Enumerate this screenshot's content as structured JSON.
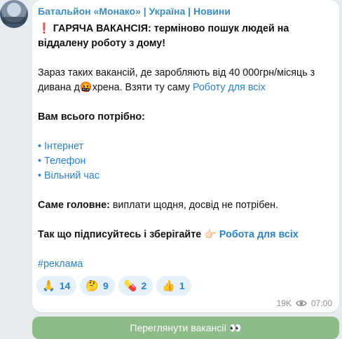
{
  "post": {
    "channel_name": "Батальйон «Монако» | Україна | Новини",
    "headline_icon": "❗",
    "headline": "ГАРЯЧА ВАКАНСІЯ: терміново пошук людей на віддалену роботу з дому!",
    "para1_part1": "Зараз таких вакансій, де заробляють від 40 000грн/місяць з дивана д",
    "para1_emoji": "🤬",
    "para1_part2": "хрена. Взяти ту саму ",
    "para1_link": "Роботу для всіх",
    "needs_title": "Вам всього потрібно:",
    "needs": [
      "• Інтернет",
      "• Телефон",
      "• Вільний час"
    ],
    "main_label": "Саме головне:",
    "main_text": " виплати щодня, досвід не потрібен.",
    "subscribe_text": "Так що підписуйтесь і зберігайте ",
    "subscribe_emoji": "👉🏻",
    "subscribe_link": "Робота для всіх",
    "hashtag": "#реклама"
  },
  "reactions": [
    {
      "emoji": "🙏",
      "count": "14"
    },
    {
      "emoji": "🤔",
      "count": "9"
    },
    {
      "emoji": "💊",
      "count": "2"
    },
    {
      "emoji": "👍",
      "count": "1"
    }
  ],
  "meta": {
    "views": "19K",
    "time": "07:00",
    "views_icon": "eye-icon"
  },
  "button": {
    "label": "Переглянути вакансії 👀"
  },
  "colors": {
    "link": "#2b82c9",
    "channel": "#3a8dc4",
    "button_bg": "#8dbb8a",
    "reaction_bg": "#e6f0f8"
  }
}
